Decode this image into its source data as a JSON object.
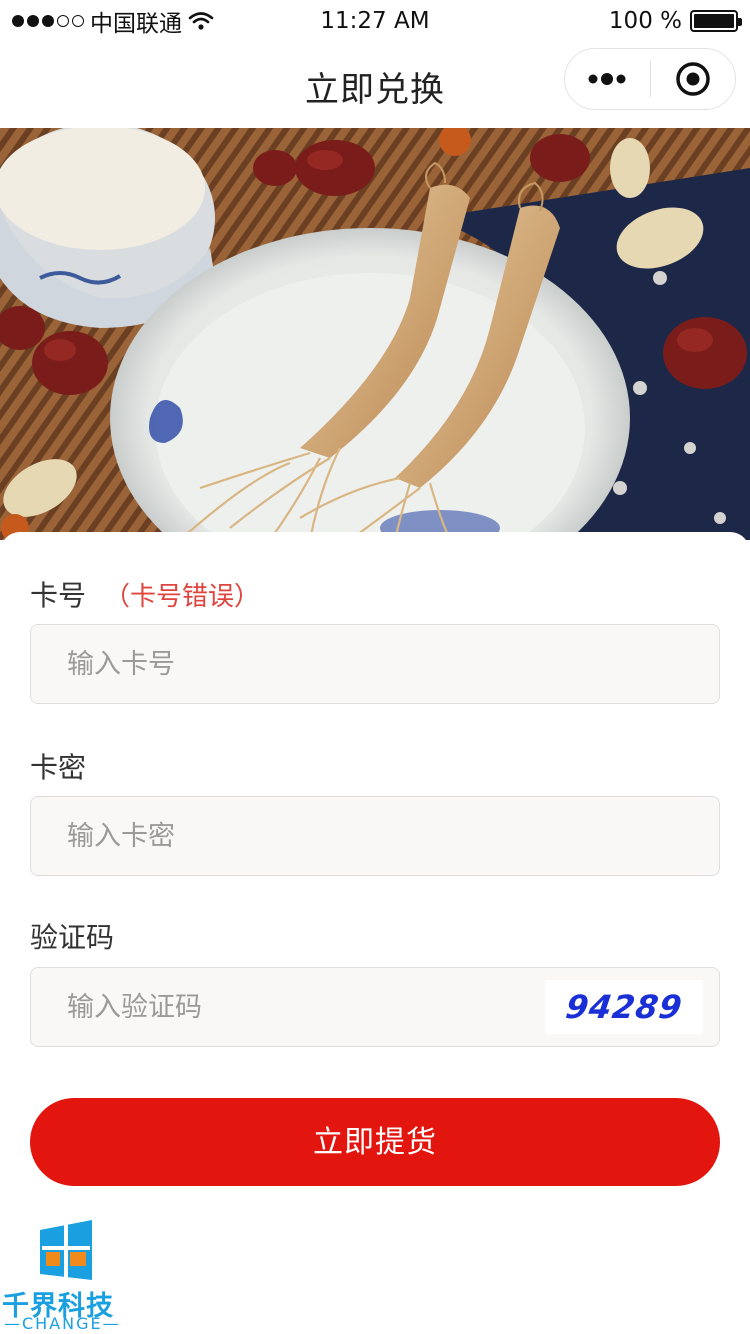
{
  "status_bar": {
    "carrier": "中国联通",
    "time": "11:27 AM",
    "battery": "100 %"
  },
  "nav": {
    "title": "立即兑换"
  },
  "form": {
    "card_label": "卡号",
    "card_error": "（卡号错误）",
    "card_placeholder": "输入卡号",
    "password_label": "卡密",
    "password_placeholder": "输入卡密",
    "captcha_label": "验证码",
    "captcha_placeholder": "输入验证码",
    "captcha_code": "94289",
    "submit_label": "立即提货"
  },
  "watermark": {
    "name": "千界科技",
    "sub": "—CHANGE—"
  },
  "colors": {
    "accent": "#e2160f",
    "error": "#e0443e",
    "captcha": "#1a2fd6",
    "logo": "#1aa0e0"
  }
}
